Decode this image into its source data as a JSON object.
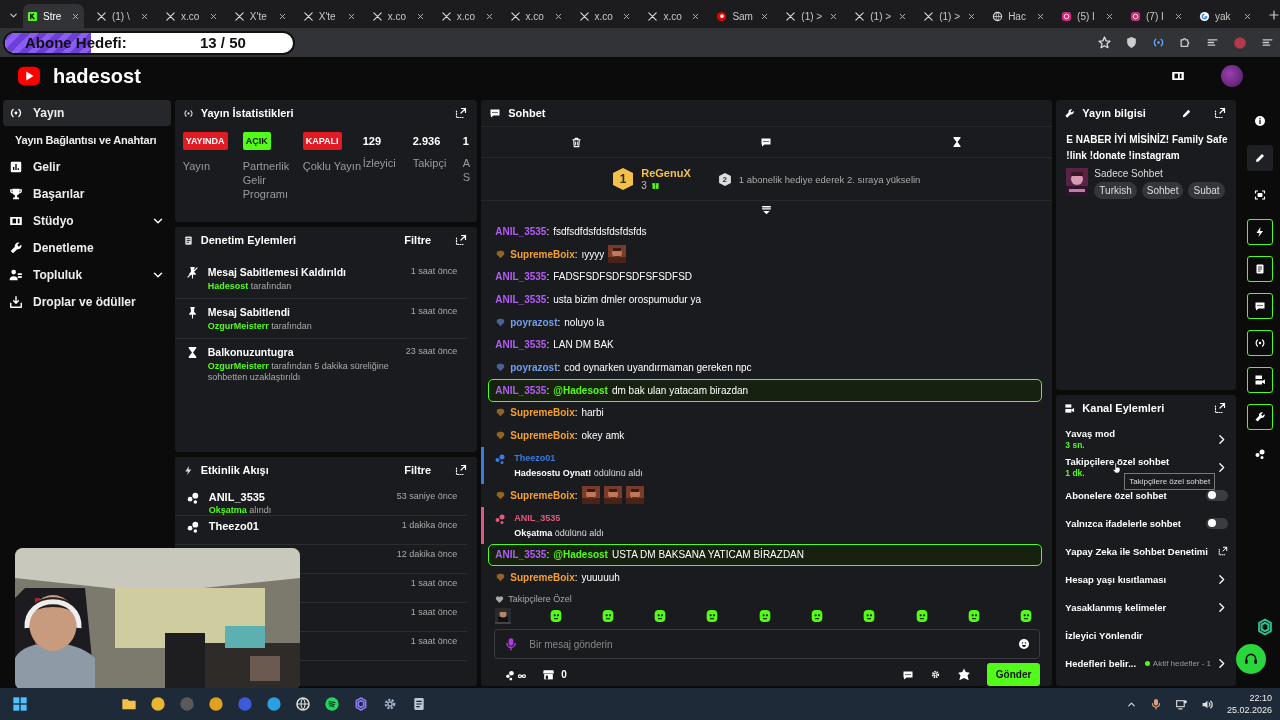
{
  "browser": {
    "tabs": [
      {
        "title": "Stre",
        "selected": true
      },
      {
        "title": "(1) \\",
        "selected": false
      },
      {
        "title": "x.co",
        "selected": false
      },
      {
        "title": "X'te",
        "selected": false
      },
      {
        "title": "X'te",
        "selected": false
      },
      {
        "title": "x.co",
        "selected": false
      },
      {
        "title": "x.co",
        "selected": false
      },
      {
        "title": "x.co",
        "selected": false
      },
      {
        "title": "x.co",
        "selected": false
      },
      {
        "title": "x.co",
        "selected": false
      },
      {
        "title": "Sam",
        "selected": false
      },
      {
        "title": "(1) >",
        "selected": false
      },
      {
        "title": "(1) >",
        "selected": false
      },
      {
        "title": "(1) >",
        "selected": false
      },
      {
        "title": "Hac",
        "selected": false
      },
      {
        "title": "(5) I",
        "selected": false
      },
      {
        "title": "(7) I",
        "selected": false
      },
      {
        "title": "yak",
        "selected": false
      }
    ],
    "overlay": {
      "label": "Abone Hedefi:",
      "count": "13 / 50",
      "level": 0.3
    }
  },
  "header": {
    "channel": "hadesost"
  },
  "sidebar": {
    "items": [
      {
        "label": "Yayın",
        "kind": "link",
        "selected": true,
        "children": [
          {
            "label": "Yayın Bağlantısı ve Anahtarı",
            "selected": false
          }
        ]
      },
      {
        "label": "Gelir",
        "kind": "link",
        "selected": false
      },
      {
        "label": "Başarılar",
        "kind": "link",
        "selected": false
      },
      {
        "label": "Stüdyo",
        "kind": "group",
        "selected": false,
        "expanded": false
      },
      {
        "label": "Denetleme",
        "kind": "link",
        "selected": false
      },
      {
        "label": "Topluluk",
        "kind": "group",
        "selected": false,
        "expanded": false
      },
      {
        "label": "Droplar ve ödüller",
        "kind": "link",
        "selected": false
      }
    ]
  },
  "stream_stats": {
    "title": "Yayın İstatistikleri",
    "tiles": [
      {
        "kind": "badge",
        "badge": "YAYINDA",
        "color": "#e01b24",
        "label": "Yayın"
      },
      {
        "kind": "badge",
        "badge": "AÇIK",
        "color": "#53fc18",
        "label": "Partnerlik Gelir Programı"
      },
      {
        "kind": "badge",
        "badge": "KAPALI",
        "color": "#e01b24",
        "label": "Çoklu Yayın"
      },
      {
        "kind": "number",
        "value": "129",
        "label": "İzleyici"
      },
      {
        "kind": "number",
        "value": "2.936",
        "label": "Takipçi"
      },
      {
        "kind": "number",
        "value": "1",
        "label": "A S"
      }
    ]
  },
  "mod_actions": {
    "title": "Denetim Eylemleri",
    "filter": "Filtre",
    "items": [
      {
        "title": "Mesaj Sabitlemesi Kaldırıldı",
        "user": "Hadesost",
        "text": "tarafından",
        "time": "1 saat önce"
      },
      {
        "title": "Mesaj Sabitlendi",
        "user": "OzgurMeisterr",
        "text": "tarafından",
        "time": "1 saat önce"
      },
      {
        "title": "Balkonuzuntugra",
        "user": "OzgurMeisterr",
        "text": "tarafından 5 dakika süreliğine sohbetten uzaklaştırıldı",
        "time": "23 saat önce"
      }
    ]
  },
  "activity": {
    "title": "Etkinlik Akışı",
    "filter": "Filtre",
    "items": [
      {
        "user": "ANIL_3535",
        "reward": "Okşatma",
        "text": "alındı",
        "time": "53 saniye önce"
      },
      {
        "user": "Theezo01",
        "time": "1 dakika önce"
      },
      {
        "time": "12 dakika önce"
      },
      {
        "time": "1 saat önce"
      },
      {
        "time": "1 saat önce"
      },
      {
        "time": "1 saat önce"
      }
    ]
  },
  "chat": {
    "title": "Sohbet",
    "leaderboard": {
      "rank": "1",
      "user": "ReGenuX",
      "count": "3",
      "next_rank": "2",
      "hint": "1 abonelik hediye ederek 2. sıraya yükselin"
    },
    "messages": [
      {
        "kind": "message",
        "user": "ANIL_3535",
        "separator": ":",
        "color": "#b25cf5",
        "text": "fsdfsdfdsfdsfdsfdsfds",
        "highlighted": false
      },
      {
        "kind": "message",
        "user": "SupremeBoix",
        "separator": ":",
        "color": "#f5a02a",
        "text": "ıyyyy",
        "highlighted": false
      },
      {
        "kind": "message",
        "user": "ANIL_3535",
        "separator": ":",
        "color": "#b25cf5",
        "text": "FADSFSDFSDFSDFSFSDFSD",
        "highlighted": false
      },
      {
        "kind": "message",
        "user": "ANIL_3535",
        "separator": ":",
        "color": "#b25cf5",
        "text": "usta bizim dmler orospumudur ya",
        "highlighted": false
      },
      {
        "kind": "message",
        "user": "poyrazost",
        "separator": ":",
        "color": "#6f9ff0",
        "text": "noluyo la",
        "highlighted": false
      },
      {
        "kind": "message",
        "user": "ANIL_3535",
        "separator": ":",
        "color": "#b25cf5",
        "text": "LAN DM BAK",
        "highlighted": false
      },
      {
        "kind": "message",
        "user": "poyrazost",
        "separator": ":",
        "color": "#6f9ff0",
        "text": "cod oynarken uyandırmaman gereken npc",
        "highlighted": false
      },
      {
        "kind": "message",
        "user": "ANIL_3535",
        "separator": ":",
        "color": "#b25cf5",
        "mention": "@Hadesost",
        "text": "dm bak ulan yatacam birazdan",
        "highlighted": true
      },
      {
        "kind": "message",
        "user": "SupremeBoix",
        "separator": ":",
        "color": "#f5a02a",
        "text": "harbi",
        "highlighted": false
      },
      {
        "kind": "message",
        "user": "SupremeBoix",
        "separator": ":",
        "color": "#f5a02a",
        "text": "okey amk",
        "highlighted": false
      },
      {
        "kind": "reward",
        "user": "Theezo01",
        "color": "#3b7be0",
        "text": "**Hadesostu Oynat!** ödülünü aldı"
      },
      {
        "kind": "message",
        "user": "SupremeBoix",
        "separator": ":",
        "color": "#f5a02a",
        "highlighted": false
      },
      {
        "kind": "reward",
        "user": "ANIL_3535",
        "color": "#e05a80",
        "text": "**Okşatma** ödülünü aldı"
      },
      {
        "kind": "message",
        "user": "ANIL_3535",
        "separator": ":",
        "color": "#b25cf5",
        "mention": "@Hadesost",
        "text": "USTA DM BAKSANA YATICAM BİRAZDAN",
        "highlighted": true
      },
      {
        "kind": "message",
        "user": "SupremeBoix",
        "separator": ":",
        "color": "#f5a02a",
        "text": "yuuuuuh",
        "highlighted": false
      }
    ],
    "emote_set": "Takipçilere Özel",
    "input": {
      "placeholder": "Bir mesaj gönderin"
    },
    "store_count": "0",
    "send": "Gönder"
  },
  "stream_info": {
    "title": "Yayın bilgisi",
    "stream_title": "E NABER İYİ MİSİNİZ! Family Safe !link !donate !instagram",
    "category": "Sadece Sohbet",
    "tags": [
      "Turkish",
      "Sohbet",
      "Subat"
    ]
  },
  "channel_actions": {
    "title": "Kanal Eylemleri",
    "tooltip": "Takipçilere özel sohbet",
    "items": [
      {
        "kind": "nav",
        "label": "Yavaş mod",
        "value": "3 sn."
      },
      {
        "kind": "nav",
        "label": "Takipçilere özel sohbet",
        "value": "1 dk."
      },
      {
        "kind": "toggle",
        "label": "Abonelere özel sohbet",
        "on": false
      },
      {
        "kind": "toggle",
        "label": "Yalnızca ifadelerle sohbet",
        "on": false
      },
      {
        "kind": "external",
        "label": "Yapay Zeka ile Sohbet Denetimi"
      },
      {
        "kind": "nav",
        "label": "Hesap yaşı kısıtlaması"
      },
      {
        "kind": "nav",
        "label": "Yasaklanmış kelimeler"
      },
      {
        "kind": "plain",
        "label": "İzleyici Yönlendir"
      },
      {
        "kind": "goal",
        "label": "Hedefleri belir...",
        "status": "Aktif hedefler - 1"
      }
    ]
  },
  "taskbar": {
    "time": "22:10",
    "date": "25.02.2026"
  }
}
